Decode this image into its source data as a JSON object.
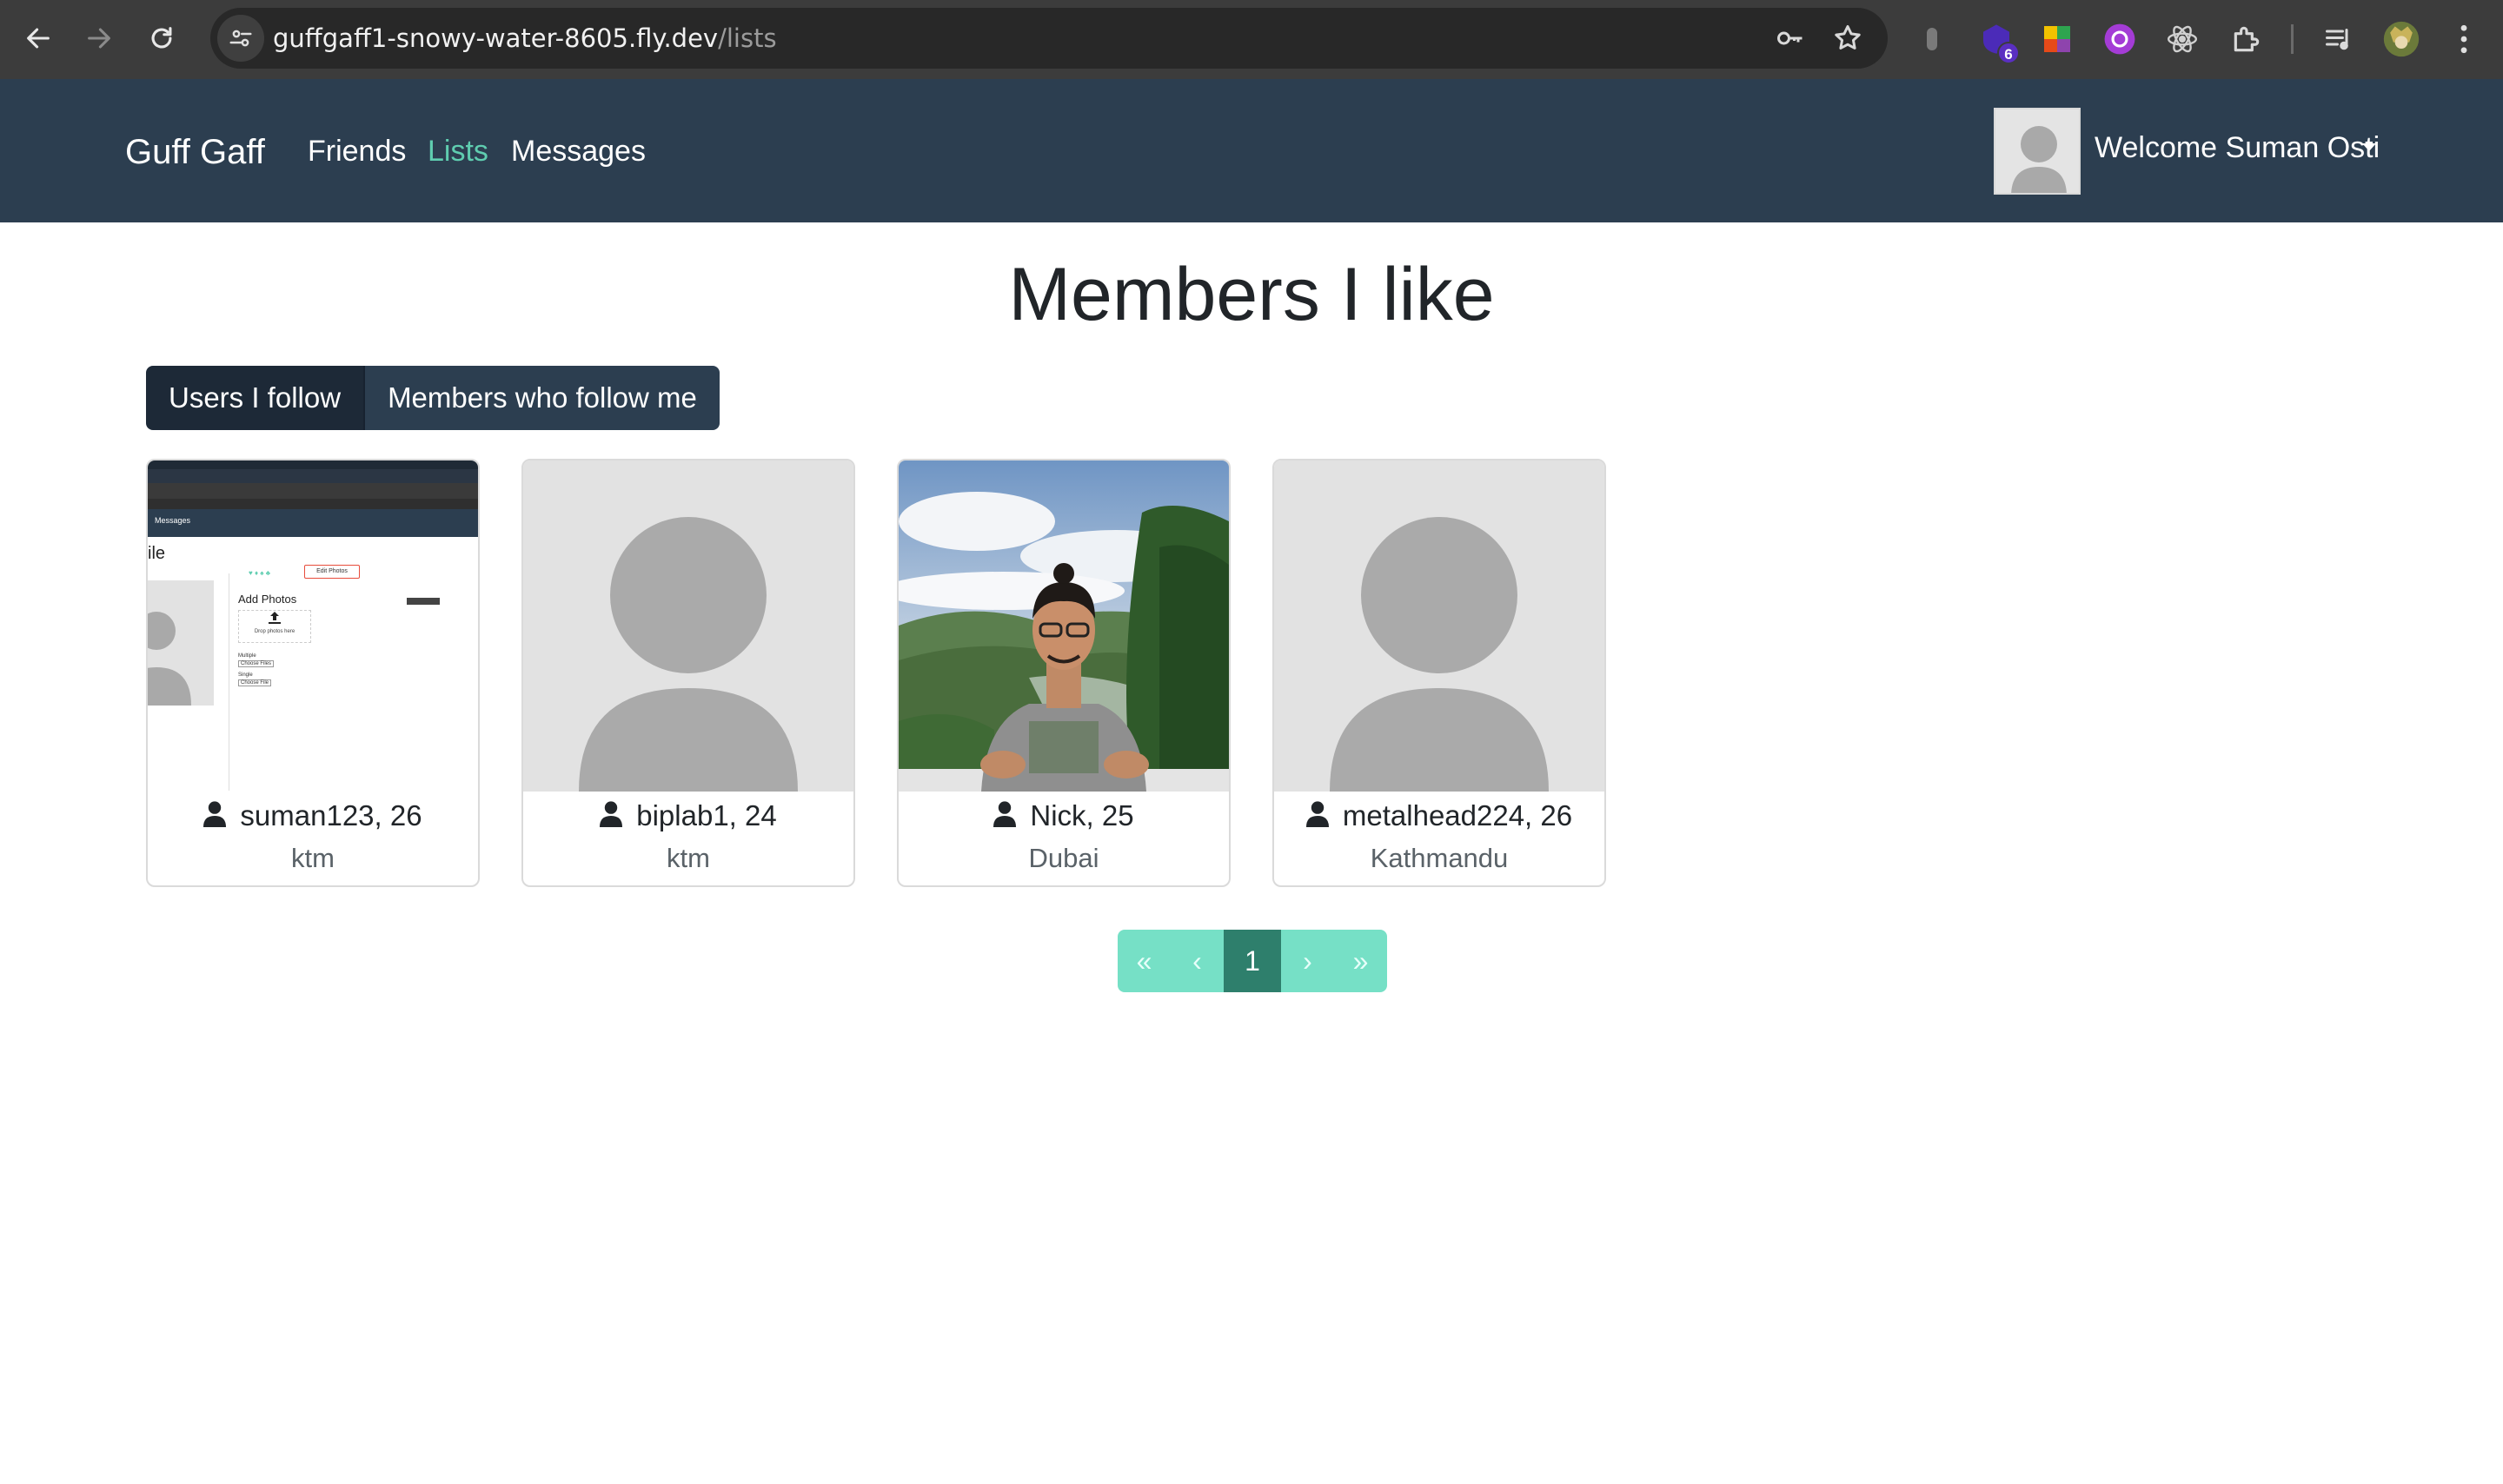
{
  "browser": {
    "url_host": "guffgaff1-snowy-water-8605.fly.dev",
    "url_path": "/lists",
    "extension_badge": "6"
  },
  "navbar": {
    "brand": "Guff Gaff",
    "links": [
      {
        "label": "Friends",
        "active": false
      },
      {
        "label": "Lists",
        "active": true
      },
      {
        "label": "Messages",
        "active": false
      }
    ],
    "welcome": "Welcome Suman Osti"
  },
  "page": {
    "title": "Members I like",
    "tabs": [
      {
        "label": "Users I follow",
        "active": true
      },
      {
        "label": "Members who follow me",
        "active": false
      }
    ]
  },
  "members": [
    {
      "name_age": "suman123, 26",
      "city": "ktm",
      "photo": "screenshot"
    },
    {
      "name_age": "biplab1, 24",
      "city": "ktm",
      "photo": "placeholder"
    },
    {
      "name_age": "Nick, 25",
      "city": "Dubai",
      "photo": "portrait"
    },
    {
      "name_age": "metalhead224, 26",
      "city": "Kathmandu",
      "photo": "placeholder"
    }
  ],
  "thumbnail_screenshot": {
    "title_fragment": "ile",
    "messages_label": "Messages",
    "add_photos": "Add Photos",
    "drop_text": "Drop photos here",
    "edit_photos": "Edit Photos",
    "multiple": "Multiple",
    "choose_files": "Choose Files",
    "single": "Single",
    "choose_file": "Choose File"
  },
  "pagination": {
    "first": "«",
    "prev": "‹",
    "current": "1",
    "next": "›",
    "last": "»"
  }
}
